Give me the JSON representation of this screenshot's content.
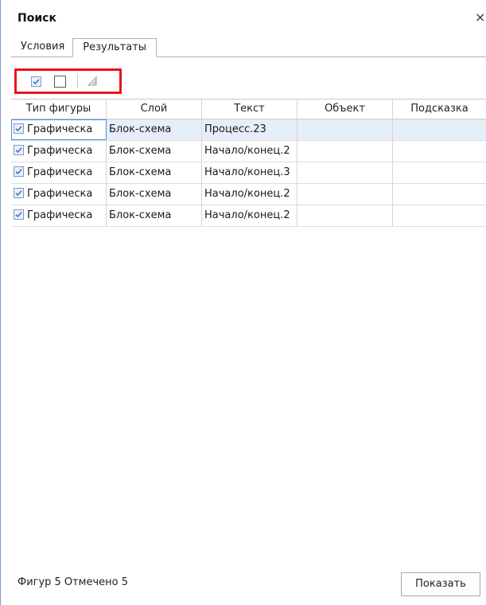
{
  "window": {
    "title": "Поиск",
    "close_symbol": "×"
  },
  "tabs": [
    {
      "label": "Условия",
      "active": false
    },
    {
      "label": "Результаты",
      "active": true
    }
  ],
  "toolbar": {
    "buttons": [
      {
        "icon": "check-all-icon"
      },
      {
        "icon": "uncheck-all-icon"
      },
      {
        "icon": "invert-selection-icon"
      }
    ]
  },
  "grid": {
    "columns": [
      "Тип фигуры",
      "Слой",
      "Текст",
      "Объект",
      "Подсказка"
    ],
    "rows": [
      {
        "checked": true,
        "type": "Графическа",
        "layer": "Блок-схема",
        "text": "Процесс.23",
        "object": "",
        "hint": ""
      },
      {
        "checked": true,
        "type": "Графическа",
        "layer": "Блок-схема",
        "text": "Начало/конец.2",
        "object": "",
        "hint": ""
      },
      {
        "checked": true,
        "type": "Графическа",
        "layer": "Блок-схема",
        "text": "Начало/конец.3",
        "object": "",
        "hint": ""
      },
      {
        "checked": true,
        "type": "Графическа",
        "layer": "Блок-схема",
        "text": "Начало/конец.2",
        "object": "",
        "hint": ""
      },
      {
        "checked": true,
        "type": "Графическа",
        "layer": "Блок-схема",
        "text": "Начало/конец.2",
        "object": "",
        "hint": ""
      }
    ]
  },
  "status": {
    "figures": "Фигур 5",
    "marked": "Отмечено 5"
  },
  "actions": {
    "show_label": "Показать"
  },
  "colors": {
    "highlight_border": "#e8141c",
    "selection_bg": "#e5eef9",
    "check_color": "#3b6fb6"
  }
}
